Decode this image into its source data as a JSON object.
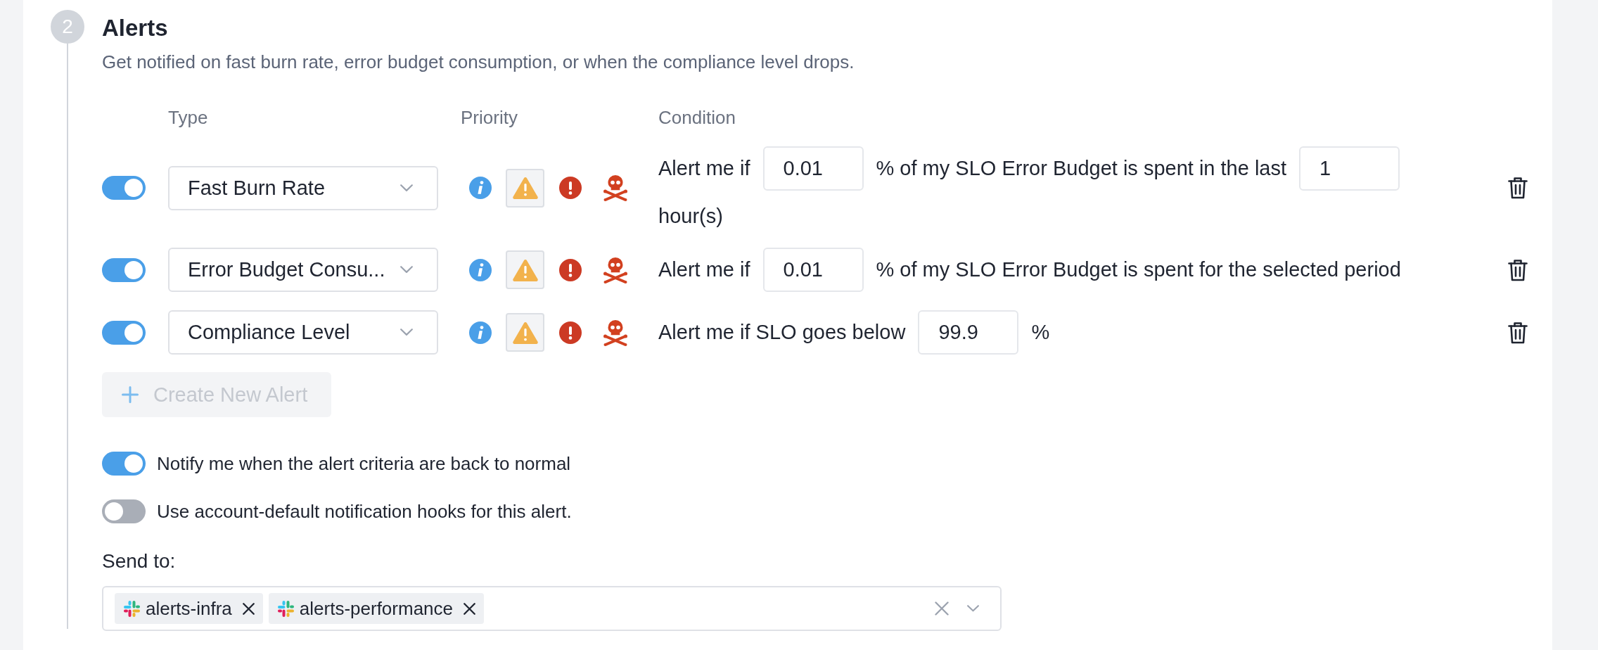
{
  "step": {
    "number": "2",
    "title": "Alerts",
    "description": "Get notified on fast burn rate, error budget consumption, or when the compliance level drops."
  },
  "columns": [
    "Type",
    "Priority",
    "Condition"
  ],
  "alerts": [
    {
      "enabled": true,
      "type": "Fast Burn Rate",
      "priorities": [
        {
          "kind": "info",
          "selected": false
        },
        {
          "kind": "warning",
          "selected": true
        },
        {
          "kind": "error",
          "selected": false
        },
        {
          "kind": "critical",
          "selected": false
        }
      ],
      "condition": [
        {
          "kind": "text",
          "text": "Alert me if"
        },
        {
          "kind": "input",
          "value": "0.01"
        },
        {
          "kind": "text",
          "text": "% of my SLO Error Budget is spent in the last"
        },
        {
          "kind": "input",
          "value": "1"
        },
        {
          "kind": "text",
          "text": "hour(s)"
        }
      ]
    },
    {
      "enabled": true,
      "type": "Error Budget Consu...",
      "priorities": [
        {
          "kind": "info",
          "selected": false
        },
        {
          "kind": "warning",
          "selected": true
        },
        {
          "kind": "error",
          "selected": false
        },
        {
          "kind": "critical",
          "selected": false
        }
      ],
      "condition": [
        {
          "kind": "text",
          "text": "Alert me if"
        },
        {
          "kind": "input",
          "value": "0.01"
        },
        {
          "kind": "text",
          "text": "% of my SLO Error Budget is spent for the selected period"
        }
      ]
    },
    {
      "enabled": true,
      "type": "Compliance Level",
      "priorities": [
        {
          "kind": "info",
          "selected": false
        },
        {
          "kind": "warning",
          "selected": true
        },
        {
          "kind": "error",
          "selected": false
        },
        {
          "kind": "critical",
          "selected": false
        }
      ],
      "condition": [
        {
          "kind": "text",
          "text": "Alert me if SLO goes below"
        },
        {
          "kind": "input",
          "value": "99.9"
        },
        {
          "kind": "text",
          "text": "%"
        }
      ]
    }
  ],
  "create_button": {
    "label": "Create New Alert",
    "disabled": true
  },
  "options": [
    {
      "label": "Notify me when the alert criteria are back to normal",
      "on": true
    },
    {
      "label": "Use account-default notification hooks for this alert.",
      "on": false
    }
  ],
  "send_to": {
    "label": "Send to:",
    "recipients": [
      "alerts-infra",
      "alerts-performance"
    ]
  }
}
